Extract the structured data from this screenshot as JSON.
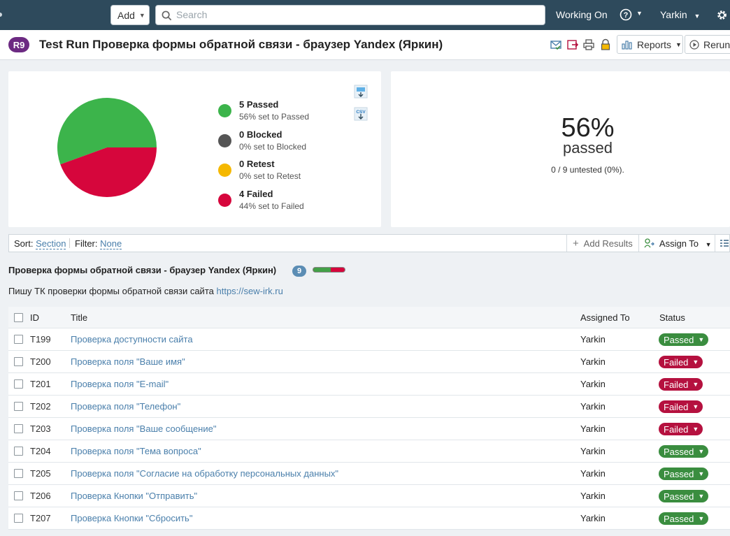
{
  "topbar": {
    "add_label": "Add",
    "search_placeholder": "Search",
    "working_on": "Working On",
    "user": "Yarkin"
  },
  "header": {
    "run_id": "R9",
    "title": "Test Run Проверка формы обратной связи - браузер Yandex (Яркин)",
    "reports_label": "Reports",
    "rerun_label": "Rerun"
  },
  "chart_data": {
    "type": "pie",
    "categories": [
      "Passed",
      "Blocked",
      "Retest",
      "Failed"
    ],
    "values": [
      5,
      0,
      0,
      4
    ],
    "colors": [
      "#3cb44b",
      "#555555",
      "#f5b800",
      "#d6063c"
    ]
  },
  "legend": [
    {
      "label": "5 Passed",
      "sub": "56% set to Passed",
      "color": "#3cb44b"
    },
    {
      "label": "0 Blocked",
      "sub": "0% set to Blocked",
      "color": "#555555"
    },
    {
      "label": "0 Retest",
      "sub": "0% set to Retest",
      "color": "#f5b800"
    },
    {
      "label": "4 Failed",
      "sub": "44% set to Failed",
      "color": "#d6063c"
    }
  ],
  "summary": {
    "percent": "56%",
    "label": "passed",
    "untested": "0 / 9 untested (0%)."
  },
  "toolbar": {
    "sort_label": "Sort:",
    "sort_value": "Section",
    "filter_label": "Filter:",
    "filter_value": "None",
    "add_results": "Add Results",
    "assign_to": "Assign To"
  },
  "section": {
    "title": "Проверка формы обратной связи - браузер Yandex (Яркин)",
    "count": "9",
    "passed_fraction": 0.56,
    "description": "Пишу ТК проверки формы обратной связи сайта",
    "link": "https://sew-irk.ru"
  },
  "table": {
    "columns": [
      "ID",
      "Title",
      "Assigned To",
      "Status"
    ],
    "rows": [
      {
        "id": "T199",
        "title": "Проверка доступности сайта",
        "assigned": "Yarkin",
        "status": "Passed"
      },
      {
        "id": "T200",
        "title": "Проверка поля \"Ваше имя\"",
        "assigned": "Yarkin",
        "status": "Failed"
      },
      {
        "id": "T201",
        "title": "Проверка поля \"E-mail\"",
        "assigned": "Yarkin",
        "status": "Failed"
      },
      {
        "id": "T202",
        "title": "Проверка поля \"Телефон\"",
        "assigned": "Yarkin",
        "status": "Failed"
      },
      {
        "id": "T203",
        "title": "Проверка поля \"Ваше сообщение\"",
        "assigned": "Yarkin",
        "status": "Failed"
      },
      {
        "id": "T204",
        "title": "Проверка поля \"Тема вопроса\"",
        "assigned": "Yarkin",
        "status": "Passed"
      },
      {
        "id": "T205",
        "title": "Проверка поля \"Согласие на обработку персональных данных\"",
        "assigned": "Yarkin",
        "status": "Passed"
      },
      {
        "id": "T206",
        "title": "Проверка Кнопки \"Отправить\"",
        "assigned": "Yarkin",
        "status": "Passed"
      },
      {
        "id": "T207",
        "title": "Проверка Кнопки \"Сбросить\"",
        "assigned": "Yarkin",
        "status": "Passed"
      }
    ]
  },
  "status_colors": {
    "Passed": "#3a8d3f",
    "Failed": "#b5113f"
  }
}
